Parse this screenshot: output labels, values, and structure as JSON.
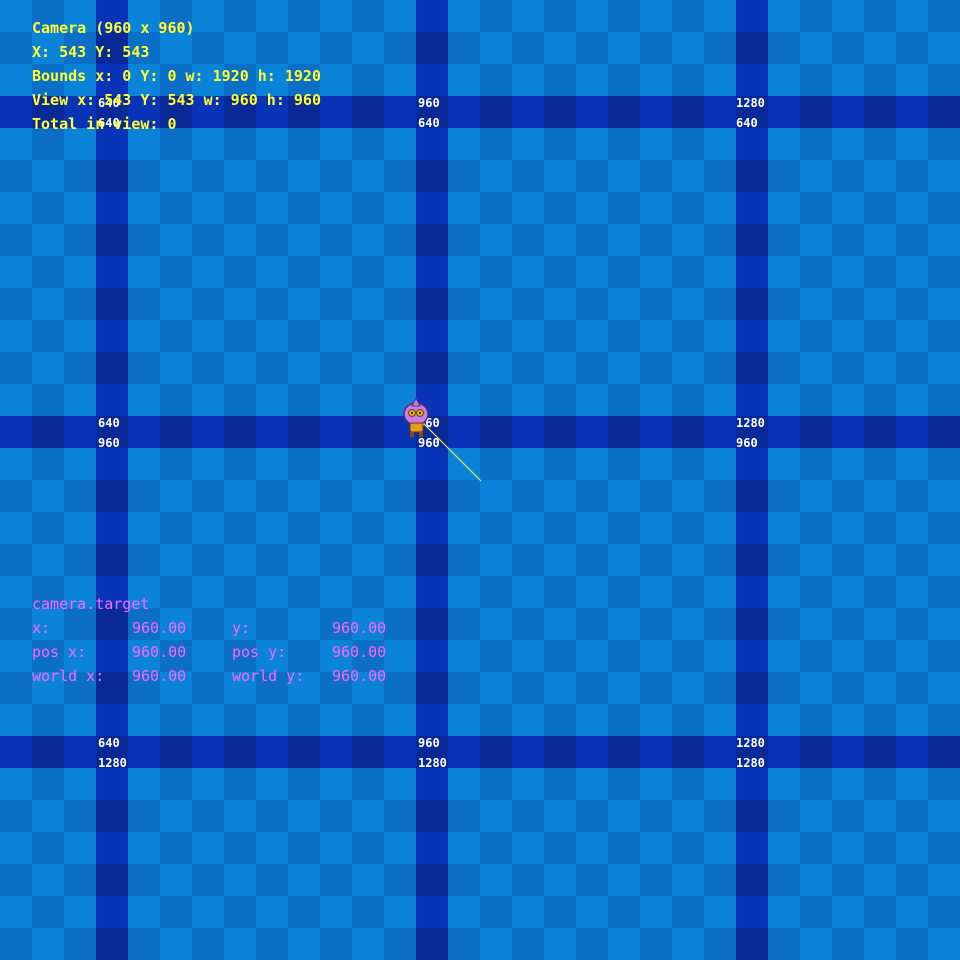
{
  "camera_debug": {
    "title": "Camera (960 x 960)",
    "position": "X: 543 Y: 543",
    "bounds": "Bounds x: 0 Y: 0 w: 1920 h: 1920",
    "view": "View x: 543 Y: 543 w: 960 h: 960",
    "total_in_view": "Total in view: 0"
  },
  "camera_target": {
    "title": "camera.target",
    "x_label": "x:",
    "x_value": "960.00",
    "y_label": "y:",
    "y_value": "960.00",
    "pos_x_label": "pos x:",
    "pos_x_value": "960.00",
    "pos_y_label": "pos y:",
    "pos_y_value": "960.00",
    "world_x_label": "world x:",
    "world_x_value": "960.00",
    "world_y_label": "world y:",
    "world_y_value": "960.00"
  },
  "grid_labels": {
    "v640": "640",
    "v960": "960",
    "v1280": "1280",
    "h640": "640",
    "h960": "960",
    "h1280": "1280"
  },
  "colors": {
    "tile_light": "#0a83d8",
    "tile_dark": "#0b6fc7",
    "band_a": "#0a34b8",
    "band_b": "#092a96",
    "debug_text": "#ffff33",
    "target_text": "#ff66ff",
    "aim_line": "#e8e84a"
  },
  "sprite": {
    "name": "player-character"
  }
}
